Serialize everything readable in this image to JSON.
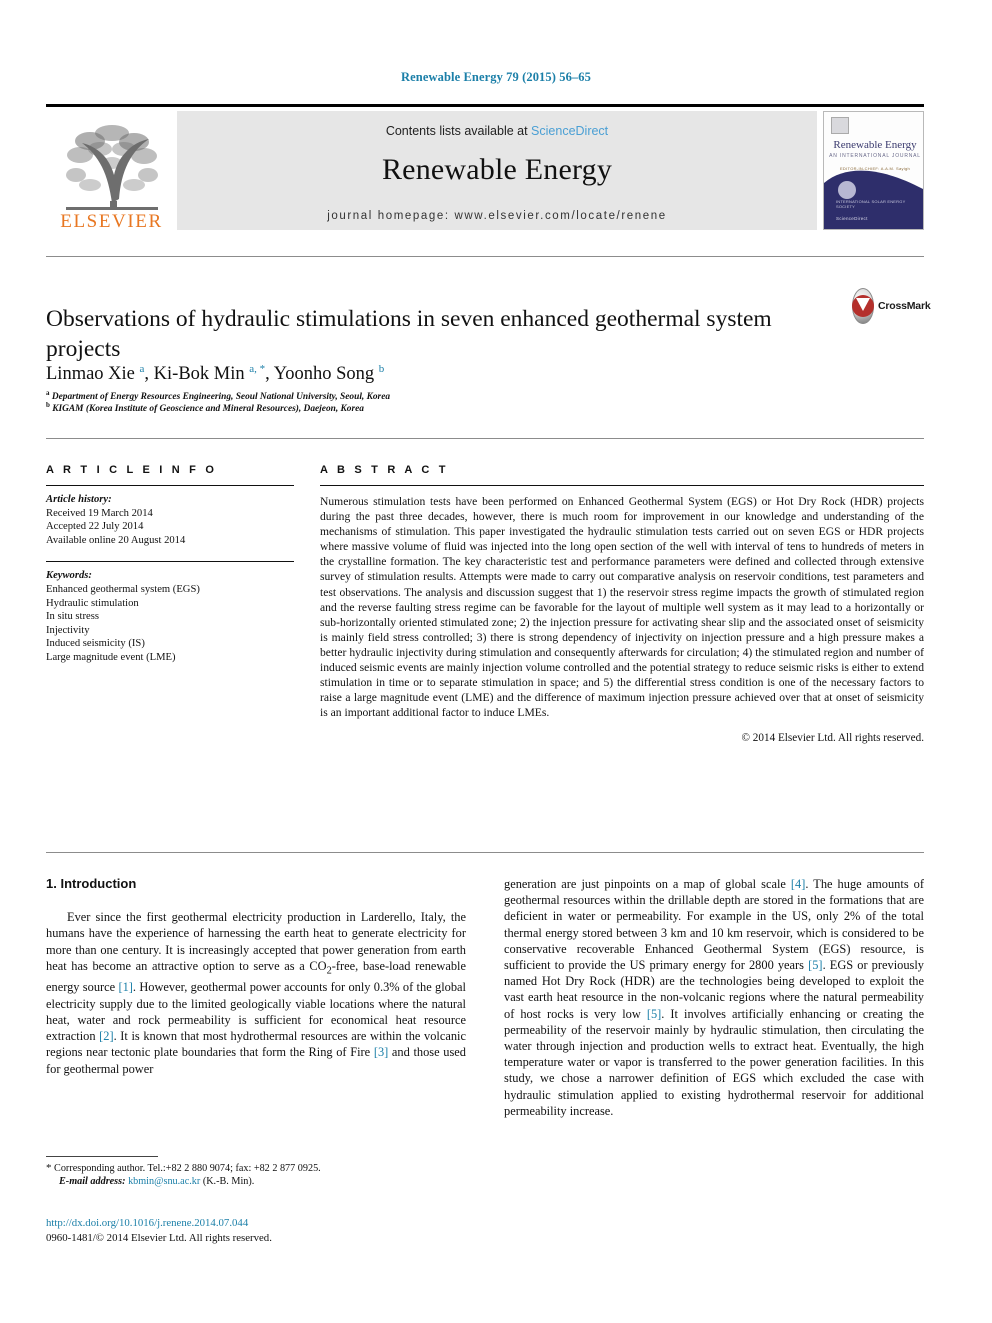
{
  "running_head": "Renewable Energy 79 (2015) 56–65",
  "masthead": {
    "publisher_name": "ELSEVIER",
    "contents_prefix": "Contents lists available at ",
    "contents_link": "ScienceDirect",
    "journal_title": "Renewable Energy",
    "homepage": "journal homepage: www.elsevier.com/locate/renene",
    "cover": {
      "title": "Renewable Energy",
      "subtitle": "AN INTERNATIONAL JOURNAL",
      "tagline": "EDITOR-IN-CHIEF: A.A.M. Sayigh",
      "footer_top": "INTERNATIONAL SOLAR ENERGY SOCIETY",
      "footer_bottom": "ScienceDirect"
    }
  },
  "article": {
    "title": "Observations of hydraulic stimulations in seven enhanced geothermal system projects",
    "crossmark_label": "CrossMark",
    "authors_html": "Linmao Xie <sup>a</sup>, Ki-Bok Min <sup>a, *</sup>, Yoonho Song <sup>b</sup>",
    "affiliations": [
      {
        "marker": "a",
        "text": "Department of Energy Resources Engineering, Seoul National University, Seoul, Korea"
      },
      {
        "marker": "b",
        "text": "KIGAM (Korea Institute of Geoscience and Mineral Resources), Daejeon, Korea"
      }
    ]
  },
  "article_info": {
    "heading": "A R T I C L E  I N F O",
    "history_label": "Article history:",
    "history": [
      "Received 19 March 2014",
      "Accepted 22 July 2014",
      "Available online 20 August 2014"
    ],
    "keywords_label": "Keywords:",
    "keywords": [
      "Enhanced geothermal system (EGS)",
      "Hydraulic stimulation",
      "In situ stress",
      "Injectivity",
      "Induced seismicity (IS)",
      "Large magnitude event (LME)"
    ]
  },
  "abstract": {
    "heading": "A B S T R A C T",
    "text": "Numerous stimulation tests have been performed on Enhanced Geothermal System (EGS) or Hot Dry Rock (HDR) projects during the past three decades, however, there is much room for improvement in our knowledge and understanding of the mechanisms of stimulation. This paper investigated the hydraulic stimulation tests carried out on seven EGS or HDR projects where massive volume of fluid was injected into the long open section of the well with interval of tens to hundreds of meters in the crystalline formation. The key characteristic test and performance parameters were defined and collected through extensive survey of stimulation results. Attempts were made to carry out comparative analysis on reservoir conditions, test parameters and test observations. The analysis and discussion suggest that 1) the reservoir stress regime impacts the growth of stimulated region and the reverse faulting stress regime can be favorable for the layout of multiple well system as it may lead to a horizontally or sub-horizontally oriented stimulated zone; 2) the injection pressure for activating shear slip and the associated onset of seismicity is mainly field stress controlled; 3) there is strong dependency of injectivity on injection pressure and a high pressure makes a better hydraulic injectivity during stimulation and consequently afterwards for circulation; 4) the stimulated region and number of induced seismic events are mainly injection volume controlled and the potential strategy to reduce seismic risks is either to extend stimulation in time or to separate stimulation in space; and 5) the differential stress condition is one of the necessary factors to raise a large magnitude event (LME) and the difference of maximum injection pressure achieved over that at onset of seismicity is an important additional factor to induce LMEs.",
    "copyright": "© 2014 Elsevier Ltd. All rights reserved."
  },
  "body": {
    "section_heading": "1.  Introduction",
    "left_paragraph_parts": [
      "Ever since the first geothermal electricity production in Larderello, Italy, the humans have the experience of harnessing the earth heat to generate electricity for more than one century. It is increasingly accepted that power generation from earth heat has become an attractive option to serve as a CO",
      "2",
      "-free, base-load renewable energy source ",
      "[1]",
      ". However, geothermal power accounts for only 0.3% of the global electricity supply due to the limited geologically viable locations where the natural heat, water and rock permeability is sufficient for economical heat resource extraction ",
      "[2]",
      ". It is known that most hydrothermal resources are within the volcanic regions near tectonic plate boundaries that form the Ring of Fire ",
      "[3]",
      " and those used for geothermal power"
    ],
    "right_paragraph_parts": [
      "generation are just pinpoints on a map of global scale ",
      "[4]",
      ". The huge amounts of geothermal resources within the drillable depth are stored in the formations that are deficient in water or permeability. For example in the US, only 2% of the total thermal energy stored between 3 km and 10 km reservoir, which is considered to be conservative recoverable Enhanced Geothermal System (EGS) resource, is sufficient to provide the US primary energy for 2800 years ",
      "[5]",
      ". EGS or previously named Hot Dry Rock (HDR) are the technologies being developed to exploit the vast earth heat resource in the non-volcanic regions where the natural permeability of host rocks is very low ",
      "[5]",
      ". It involves artificially enhancing or creating the permeability of the reservoir mainly by hydraulic stimulation, then circulating the water through injection and production wells to extract heat. Eventually, the high temperature water or vapor is transferred to the power generation facilities. In this study, we chose a narrower definition of EGS which excluded the case with hydraulic stimulation applied to existing hydrothermal reservoir for additional permeability increase."
    ]
  },
  "footnotes": {
    "corresponding_marker": "*",
    "corresponding_text": "Corresponding author. Tel.:+82 2 880 9074; fax: +82 2 877 0925.",
    "email_label": "E-mail address:",
    "email": "kbmin@snu.ac.kr",
    "email_suffix": "(K.-B. Min).",
    "doi": "http://dx.doi.org/10.1016/j.renene.2014.07.044",
    "issn_line": "0960-1481/© 2014 Elsevier Ltd. All rights reserved."
  },
  "colors": {
    "link": "#1b7fa8",
    "sciencedirect": "#4a9fd4",
    "elsevier_orange": "#E87722",
    "banner_bg": "#e6e6e6",
    "cover_navy": "#2e2e6b",
    "crossmark_red": "#b4302c"
  }
}
